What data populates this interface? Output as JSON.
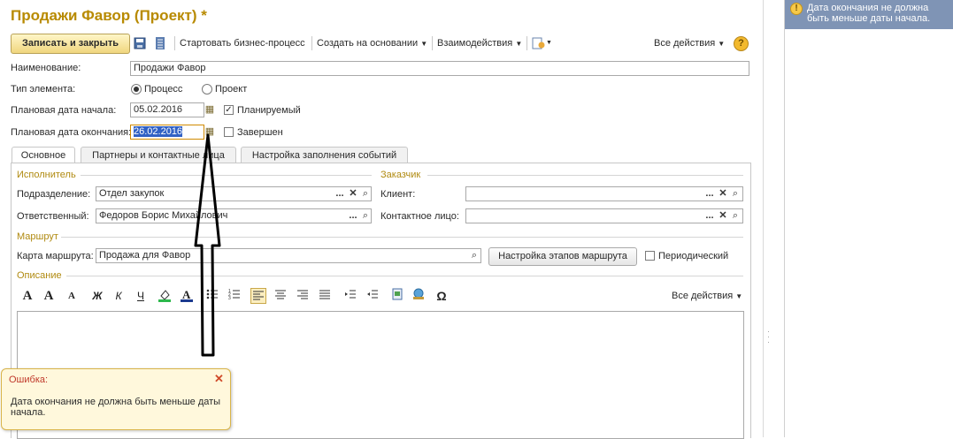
{
  "window": {
    "title": "Продажи Фавор (Проект) *"
  },
  "toolbar": {
    "save_close": "Записать и закрыть",
    "start_process": "Стартовать бизнес-процесс",
    "create_based": "Создать на основании",
    "interactions": "Взаимодействия",
    "all_actions": "Все действия",
    "help": "?"
  },
  "form": {
    "name_label": "Наименование:",
    "name_value": "Продажи Фавор",
    "type_label": "Тип элемента:",
    "type_process": "Процесс",
    "type_project": "Проект",
    "start_label": "Плановая дата начала:",
    "start_value": "05.02.2016",
    "planned_label": "Планируемый",
    "end_label": "Плановая дата окончания:",
    "end_value": "26.02.2016",
    "done_label": "Завершен"
  },
  "tabs": [
    {
      "label": "Основное"
    },
    {
      "label": "Партнеры и контактные лица"
    },
    {
      "label": "Настройка заполнения событий"
    }
  ],
  "main": {
    "executor_section": "Исполнитель",
    "customer_section": "Заказчик",
    "dept_label": "Подразделение:",
    "dept_value": "Отдел закупок",
    "resp_label": "Ответственный:",
    "resp_value": "Федоров Борис Михайлович",
    "client_label": "Клиент:",
    "client_value": "",
    "contact_label": "Контактное лицо:",
    "contact_value": "",
    "route_section": "Маршрут",
    "route_label": "Карта маршрута:",
    "route_value": "Продажа для Фавор",
    "route_btn": "Настройка этапов маршрута",
    "periodic_label": "Периодический",
    "desc_section": "Описание",
    "editor_all_actions": "Все действия",
    "select_btn": "...",
    "clear_btn": "✕"
  },
  "editor_toolbar": [
    "A",
    "A",
    "A",
    "Ж",
    "К",
    "Ч"
  ],
  "message_panel": {
    "text": "Дата окончания не должна быть меньше даты начала."
  },
  "error_popup": {
    "title": "Ошибка:",
    "text": "Дата окончания не должна быть меньше даты начала."
  },
  "colors": {
    "title": "#b88a00",
    "section": "#b08a10",
    "message_bg": "#7f94b5",
    "error_bg": "#fff8dc",
    "error_title": "#c0392b"
  }
}
